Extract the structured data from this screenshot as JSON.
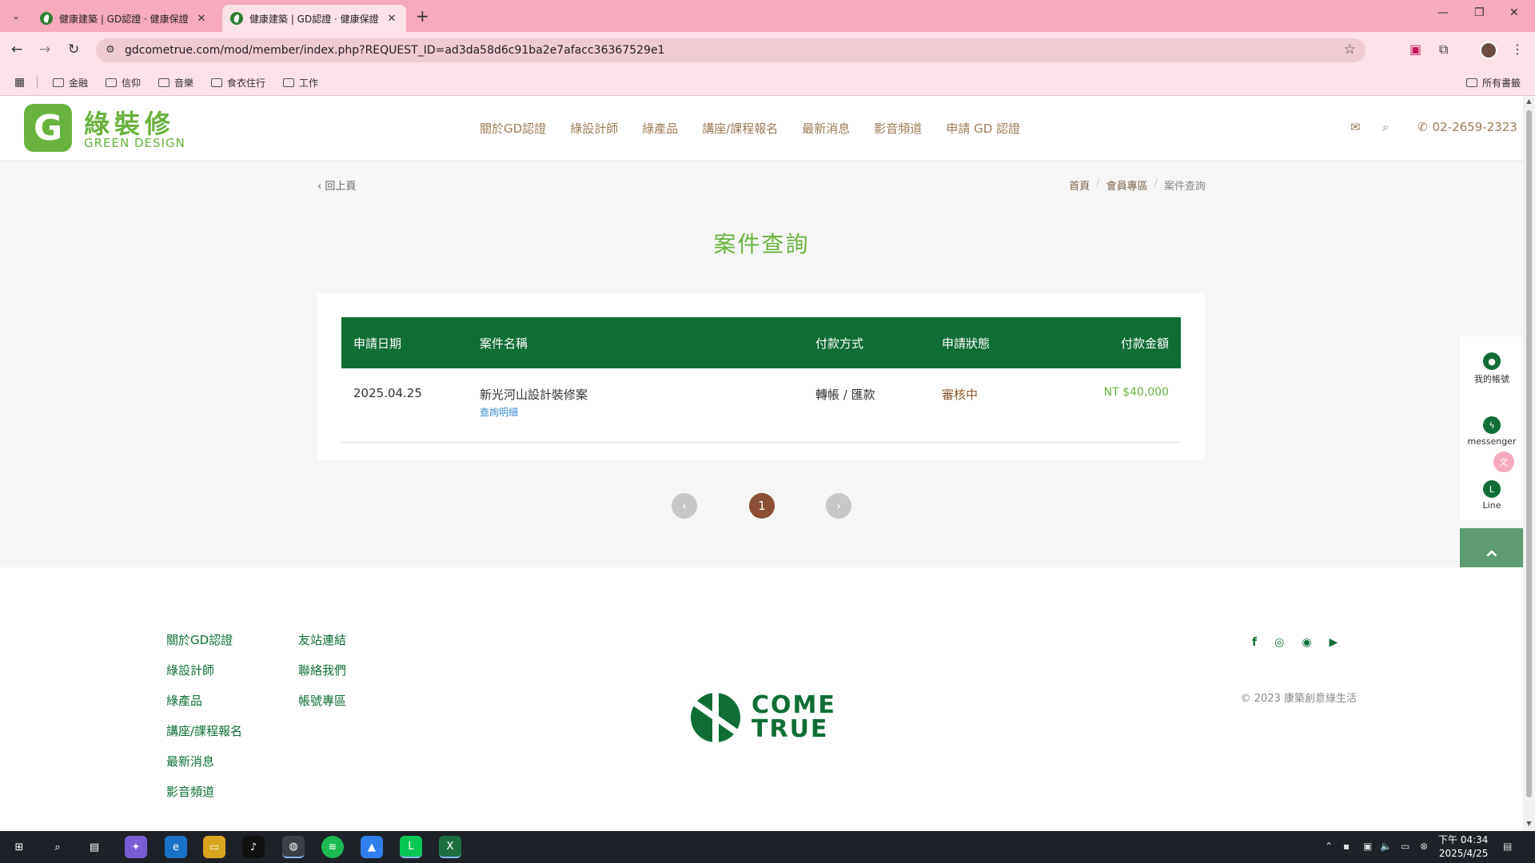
{
  "browser": {
    "tabs": [
      {
        "title": "健康建築 | GD認證 · 健康保證",
        "active": false
      },
      {
        "title": "健康建築 | GD認證 · 健康保證",
        "active": true
      }
    ],
    "url": "gdcometrue.com/mod/member/index.php?REQUEST_ID=ad3da58d6c91ba2e7afacc36367529e1",
    "bookmarks": [
      "金融",
      "信仰",
      "音樂",
      "食衣住行",
      "工作"
    ],
    "all_bookmarks_label": "所有書籤"
  },
  "site": {
    "logo_cn": "綠裝修",
    "logo_en": "GREEN DESIGN",
    "nav": [
      "關於GD認證",
      "綠設計師",
      "綠產品",
      "講座/課程報名",
      "最新消息",
      "影音頻道",
      "申請 GD 認證"
    ],
    "phone": "02-2659-2323"
  },
  "page": {
    "back_label": "回上頁",
    "breadcrumb": [
      "首頁",
      "會員專區",
      "案件查詢"
    ],
    "title": "案件查詢"
  },
  "table": {
    "headers": {
      "date": "申請日期",
      "name": "案件名稱",
      "payment": "付款方式",
      "status": "申請狀態",
      "amount": "付款金額"
    },
    "rows": [
      {
        "date": "2025.04.25",
        "name": "新光河山設計裝修案",
        "detail_link": "查詢明細",
        "payment": "轉帳 / 匯款",
        "status": "審核中",
        "amount": "NT $40,000"
      }
    ]
  },
  "pagination": {
    "current": "1"
  },
  "side_widget": {
    "account": "我的帳號",
    "messenger": "messenger",
    "line": "Line"
  },
  "footer": {
    "col1": [
      "關於GD認證",
      "綠設計師",
      "綠產品",
      "講座/課程報名",
      "最新消息",
      "影音頻道"
    ],
    "col2": [
      "友站連結",
      "聯絡我們",
      "帳號專區"
    ],
    "brand_line1": "COME",
    "brand_line2": "TRUE",
    "copyright": "© 2023 康築創意綠生活"
  },
  "taskbar": {
    "time": "下午 04:34",
    "date": "2025/4/25"
  },
  "colors": {
    "brand_green": "#0f6e36",
    "accent_green": "#6ab23e",
    "nav_brown": "#9b7b56",
    "chrome_pink": "#f7a9bd"
  }
}
